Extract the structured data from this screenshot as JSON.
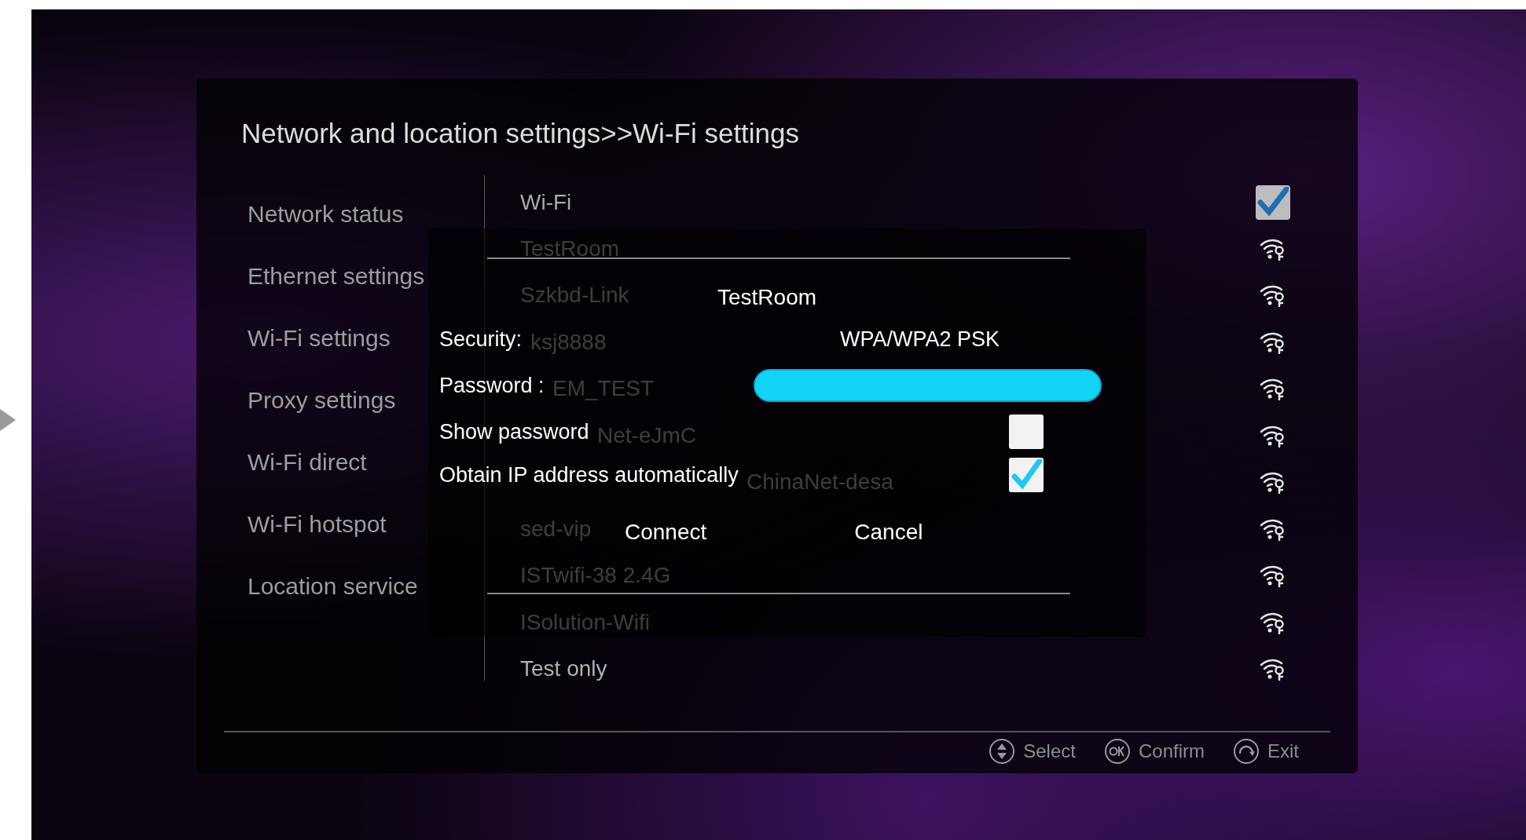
{
  "breadcrumb": "Network and location settings>>Wi-Fi settings",
  "menu": [
    {
      "label": "Network status"
    },
    {
      "label": "Ethernet settings"
    },
    {
      "label": "Wi-Fi settings"
    },
    {
      "label": "Proxy settings"
    },
    {
      "label": "Wi-Fi direct"
    },
    {
      "label": "Wi-Fi hotspot"
    },
    {
      "label": "Location service"
    }
  ],
  "wifi": {
    "label": "Wi-Fi",
    "checked": true
  },
  "networks": [
    {
      "name": "TestRoom"
    },
    {
      "name": "Szkbd-Link"
    },
    {
      "name": "ksj8888"
    },
    {
      "name": "EM_TEST"
    },
    {
      "name": "Net-eJmC"
    },
    {
      "name": "ChinaNet-desa"
    },
    {
      "name": "sed-vip"
    },
    {
      "name": "ISTwifi-38 2.4G"
    },
    {
      "name": "ISolution-Wifi"
    },
    {
      "name": "Test only"
    }
  ],
  "dialog": {
    "network": "TestRoom",
    "fields": [
      {
        "kind": "value",
        "label": "Security:",
        "value": "WPA/WPA2 PSK"
      },
      {
        "kind": "password",
        "label": "Password :"
      },
      {
        "kind": "checkbox",
        "label": "Show password",
        "checked": false
      },
      {
        "kind": "checkbox",
        "label": "Obtain IP address automatically",
        "checked": true
      }
    ],
    "buttons": [
      "Connect",
      "Cancel"
    ]
  },
  "footer": [
    {
      "kind": "select",
      "label": "Select"
    },
    {
      "kind": "ok",
      "label": "Confirm"
    },
    {
      "kind": "back",
      "label": "Exit"
    }
  ]
}
